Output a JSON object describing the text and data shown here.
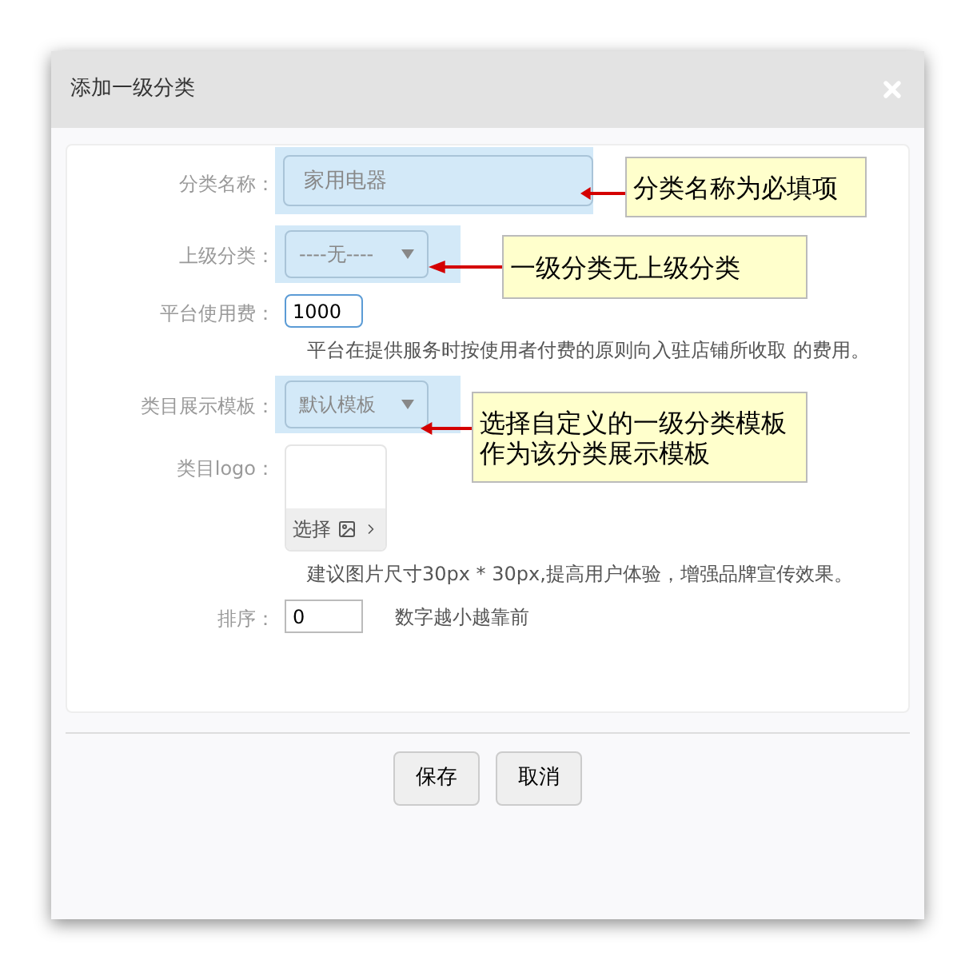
{
  "dialog": {
    "title": "添加一级分类"
  },
  "fields": [
    {
      "kind": "text",
      "label": "分类名称：",
      "value": "家用电器",
      "highlighted": true
    },
    {
      "kind": "select",
      "label": "上级分类：",
      "value": "----无----",
      "highlighted": true
    },
    {
      "kind": "small",
      "label": "平台使用费：",
      "value": "1000",
      "focused": true,
      "hint": "平台在提供服务时按使用者付费的原则向入驻店铺所收取 的费用。"
    },
    {
      "kind": "select",
      "label": "类目展示模板：",
      "value": "默认模板",
      "highlighted": true
    },
    {
      "kind": "image",
      "label": "类目logo：",
      "button": "选择",
      "hint": "建议图片尺寸30px * 30px,提高用户体验，增强品牌宣传效果。"
    },
    {
      "kind": "small",
      "label": "排序：",
      "value": "0",
      "focused": false,
      "note": "数字越小越靠前"
    }
  ],
  "callouts": [
    {
      "lines": [
        "分类名称为必填项"
      ]
    },
    {
      "lines": [
        "一级分类无上级分类"
      ]
    },
    {
      "lines": [
        "选择自定义的一级分类模板",
        "作为该分类展示模板"
      ]
    }
  ],
  "buttons": [
    "保存",
    "取消"
  ]
}
